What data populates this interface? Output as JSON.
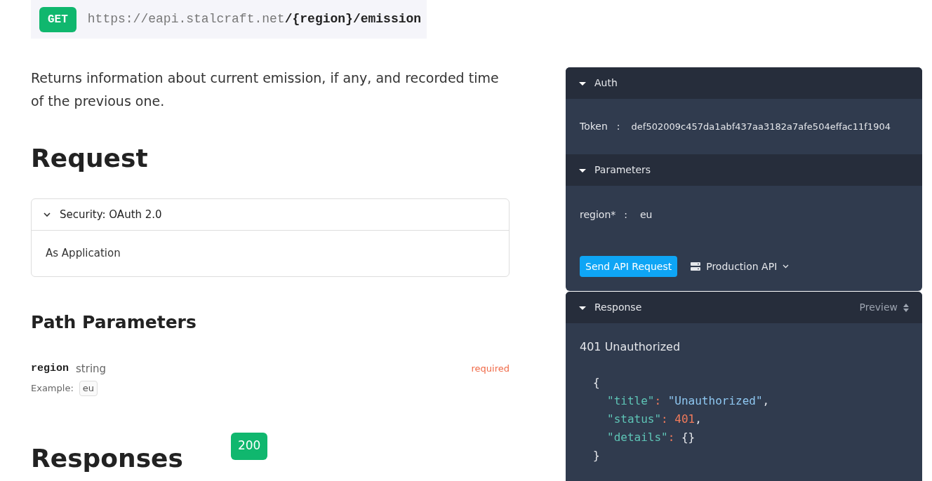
{
  "endpoint": {
    "method": "GET",
    "url": "https://eapi.stalcraft.net**/{region}/emission**"
  },
  "description": "Returns information about current emission, if any, and recorded time of the previous one.",
  "request": {
    "heading": "Request",
    "security": {
      "title": "Security: OAuth 2.0",
      "expanded": true,
      "body": "As Application"
    },
    "path_parameters": {
      "heading": "Path Parameters",
      "items": [
        {
          "name": "region",
          "type": "string",
          "required": "required",
          "example_label": "Example:",
          "example": "eu"
        }
      ]
    }
  },
  "responses": {
    "heading": "Responses",
    "status": "200"
  },
  "console": {
    "auth": {
      "title": "Auth",
      "expanded": true,
      "label": "Token",
      "separator": ":",
      "value": "def502009c457da1abf437aa3182a7afe504effac11f1904"
    },
    "parameters": {
      "title": "Parameters",
      "expanded": true,
      "items": [
        {
          "label": "region*",
          "separator": ":",
          "value": "eu"
        }
      ]
    },
    "send_button": "Send API Request",
    "server": "Production API",
    "response": {
      "title": "Response",
      "expanded": true,
      "view": "Preview",
      "status_line": "401 Unauthorized",
      "code": [
        [
          {
            "kind": "punct",
            "text": "{"
          }
        ],
        [
          {
            "kind": "key",
            "text": "\"title\""
          },
          {
            "kind": "punct",
            "text": ": "
          },
          {
            "kind": "string",
            "text": "\"Unauthorized\""
          },
          {
            "kind": "plain",
            "text": ","
          }
        ],
        [
          {
            "kind": "key",
            "text": "\"status\""
          },
          {
            "kind": "punct",
            "text": ": "
          },
          {
            "kind": "number",
            "text": "401"
          },
          {
            "kind": "plain",
            "text": ","
          }
        ],
        [
          {
            "kind": "key",
            "text": "\"details\""
          },
          {
            "kind": "punct",
            "text": ": "
          },
          {
            "kind": "plain",
            "text": "{}"
          }
        ],
        [
          {
            "kind": "punct",
            "text": "}"
          }
        ]
      ]
    }
  }
}
